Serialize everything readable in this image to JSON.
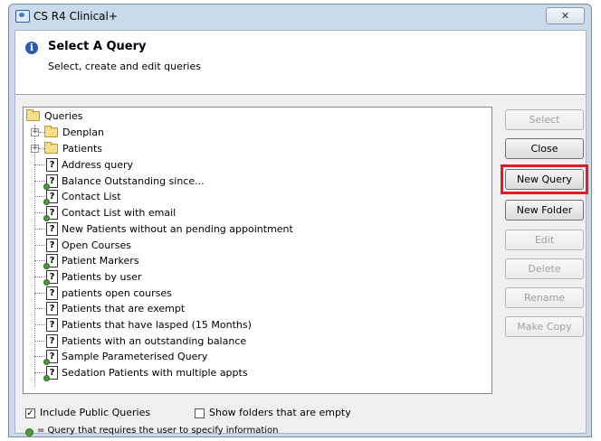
{
  "window": {
    "title": "CS R4 Clinical+",
    "close_glyph": "✕"
  },
  "header": {
    "title": "Select A Query",
    "subtitle": "Select, create and edit queries"
  },
  "tree": {
    "root": "Queries",
    "folders": [
      "Denplan",
      "Patients"
    ],
    "queries": [
      {
        "label": "Address query",
        "param": false
      },
      {
        "label": "Balance Outstanding since...",
        "param": true
      },
      {
        "label": "Contact List",
        "param": true
      },
      {
        "label": "Contact List with email",
        "param": true
      },
      {
        "label": "New Patients without an pending appointment",
        "param": false
      },
      {
        "label": "Open Courses",
        "param": false
      },
      {
        "label": "Patient Markers",
        "param": true
      },
      {
        "label": "Patients by user",
        "param": true
      },
      {
        "label": "patients open courses",
        "param": false
      },
      {
        "label": "Patients that are exempt",
        "param": false
      },
      {
        "label": "Patients that have lasped (15 Months)",
        "param": false
      },
      {
        "label": "Patients with an outstanding balance",
        "param": false
      },
      {
        "label": "Sample Parameterised Query",
        "param": true
      },
      {
        "label": "Sedation Patients with multiple appts",
        "param": true
      }
    ]
  },
  "buttons": {
    "select": "Select",
    "close": "Close",
    "new_query": "New Query",
    "new_folder": "New Folder",
    "edit": "Edit",
    "delete": "Delete",
    "rename": "Rename",
    "make_copy": "Make Copy"
  },
  "options": {
    "include_public": "Include Public Queries",
    "include_public_checked": true,
    "show_empty_folders": "Show folders that are empty",
    "show_empty_folders_checked": false
  },
  "legend": "= Query that requires the user to specify information",
  "colors": {
    "highlight": "#e01b24",
    "param_marker": "#4a9d3a"
  }
}
